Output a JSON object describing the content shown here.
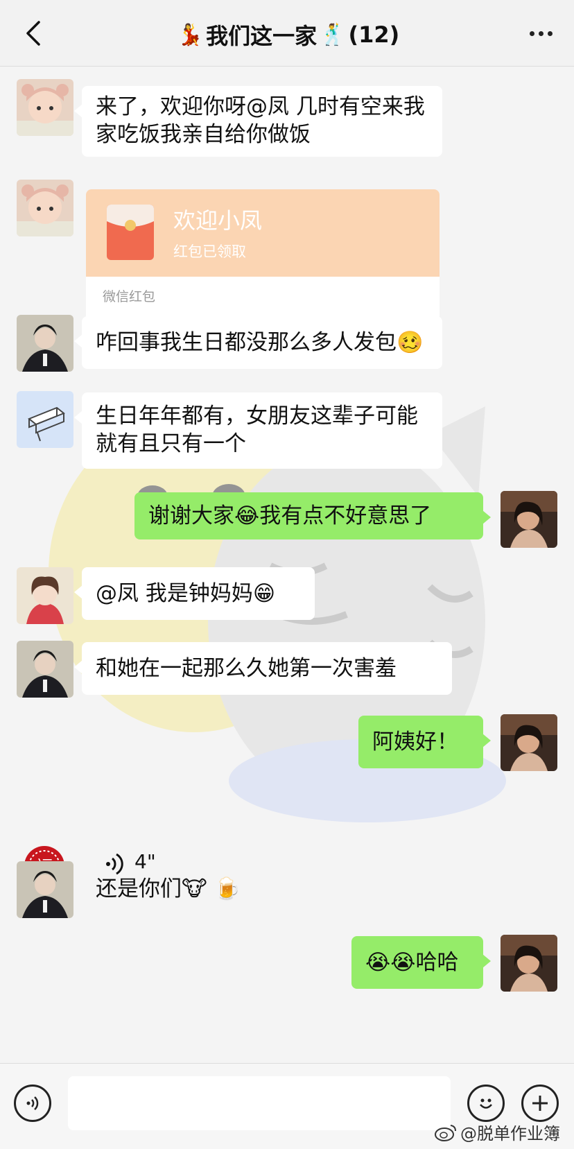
{
  "header": {
    "title_prefix_emoji": "💃",
    "title": "我们这一家",
    "title_suffix_emoji": "🕺",
    "member_count": "(12)"
  },
  "messages": {
    "m1": "来了，欢迎你呀@凤 几时有空来我家吃饭我亲自给你做饭",
    "redpacket": {
      "title": "欢迎小凤",
      "status": "红包已领取",
      "footer": "微信红包"
    },
    "m3": "咋回事我生日都没那么多人发包🥴",
    "m4": "生日年年都有，女朋友这辈子可能就有且只有一个",
    "m5": "谢谢大家😂我有点不好意思了",
    "m6": "@凤 我是钟妈妈😁",
    "m7": "和她在一起那么久她第一次害羞",
    "m8": "阿姨好！",
    "voice_duration": "4\"",
    "m10": "还是你们🐮 🍺",
    "m11": "😭😭哈哈"
  },
  "avatar_stamp_char": "福",
  "watermark": "@脱单作业簿"
}
